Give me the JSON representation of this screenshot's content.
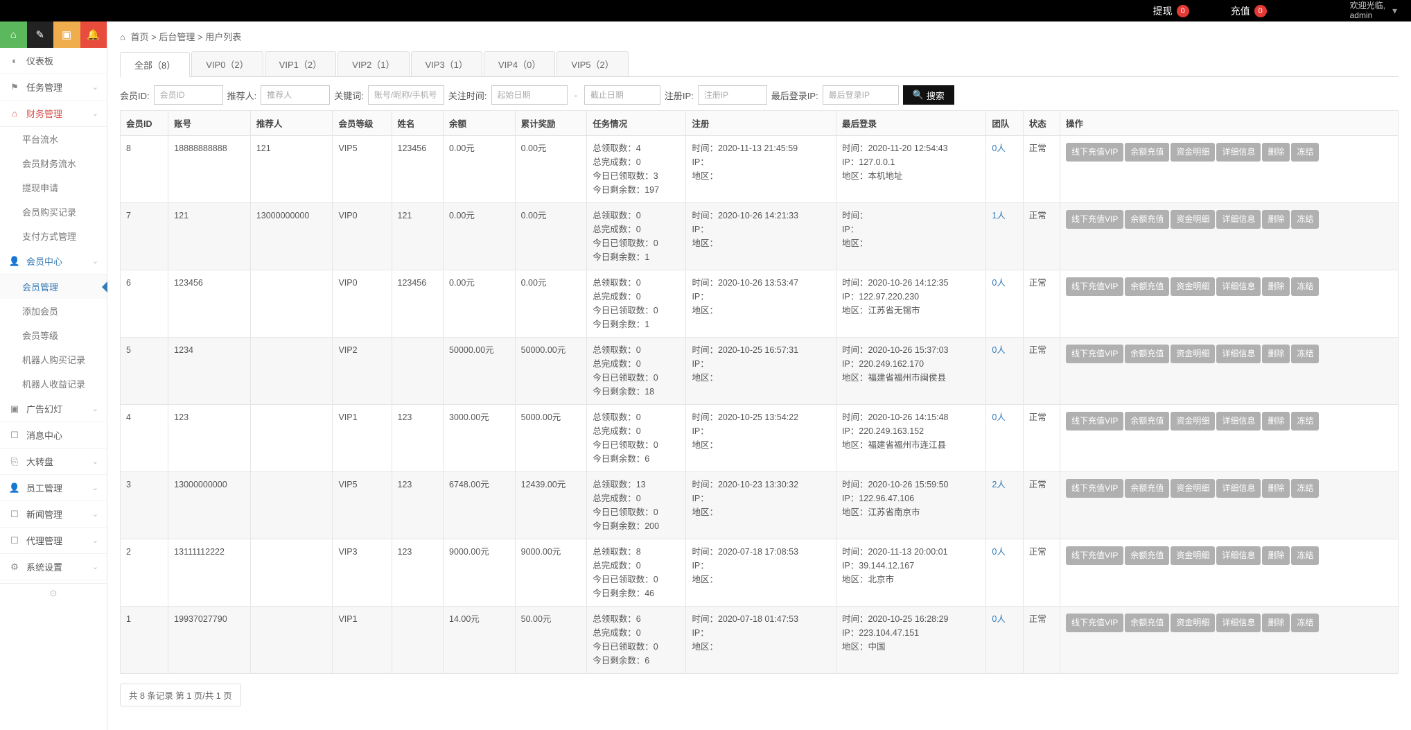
{
  "topbar": {
    "withdraw_label": "提现",
    "withdraw_count": "0",
    "recharge_label": "充值",
    "recharge_count": "0",
    "welcome": "欢迎光临,",
    "username": "admin"
  },
  "breadcrumb": {
    "home": "首页",
    "sep": ">",
    "p1": "后台管理",
    "p2": "用户列表"
  },
  "sidebar": {
    "items": [
      {
        "icon": "◐",
        "label": "仪表板",
        "nameKey": "dashboard"
      },
      {
        "icon": "⚑",
        "label": "任务管理",
        "nameKey": "tasks",
        "chev": true
      },
      {
        "icon": "⌂",
        "label": "财务管理",
        "nameKey": "finance",
        "chev": true,
        "open": true,
        "sub": [
          {
            "label": "平台流水"
          },
          {
            "label": "会员财务流水"
          },
          {
            "label": "提现申请"
          },
          {
            "label": "会员购买记录"
          },
          {
            "label": "支付方式管理"
          }
        ]
      },
      {
        "icon": "👤",
        "label": "会员中心",
        "nameKey": "member",
        "chev": true,
        "activeParent": true,
        "sub": [
          {
            "label": "会员管理",
            "active": true
          },
          {
            "label": "添加会员"
          },
          {
            "label": "会员等级"
          },
          {
            "label": "机器人购买记录"
          },
          {
            "label": "机器人收益记录"
          }
        ]
      },
      {
        "icon": "▣",
        "label": "广告幻灯",
        "nameKey": "ads",
        "chev": true
      },
      {
        "icon": "☐",
        "label": "消息中心",
        "nameKey": "messages"
      },
      {
        "icon": "⎘",
        "label": "大转盘",
        "nameKey": "wheel",
        "chev": true
      },
      {
        "icon": "👤",
        "label": "员工管理",
        "nameKey": "staff",
        "chev": true
      },
      {
        "icon": "☐",
        "label": "新闻管理",
        "nameKey": "news",
        "chev": true
      },
      {
        "icon": "☐",
        "label": "代理管理",
        "nameKey": "agent",
        "chev": true
      },
      {
        "icon": "⚙",
        "label": "系统设置",
        "nameKey": "settings",
        "chev": true
      }
    ],
    "collapse_icon": "⊙"
  },
  "tabs": [
    {
      "label": "全部（8）",
      "active": true
    },
    {
      "label": "VIP0（2）"
    },
    {
      "label": "VIP1（2）"
    },
    {
      "label": "VIP2（1）"
    },
    {
      "label": "VIP3（1）"
    },
    {
      "label": "VIP4（0）"
    },
    {
      "label": "VIP5（2）"
    }
  ],
  "filters": {
    "member_id_label": "会员ID:",
    "member_id_ph": "会员ID",
    "referrer_label": "推荐人:",
    "referrer_ph": "推荐人",
    "keyword_label": "关键词:",
    "keyword_ph": "账号/昵称/手机号",
    "close_time_label": "关注时间:",
    "start_ph": "起始日期",
    "end_ph": "截止日期",
    "reg_ip_label": "注册IP:",
    "reg_ip_ph": "注册IP",
    "last_ip_label": "最后登录IP:",
    "last_ip_ph": "最后登录IP",
    "search_label": "搜索"
  },
  "columns": [
    "会员ID",
    "账号",
    "推荐人",
    "会员等级",
    "姓名",
    "余额",
    "累计奖励",
    "任务情况",
    "注册",
    "最后登录",
    "团队",
    "状态",
    "操作"
  ],
  "task_labels": {
    "total": "总领取数：",
    "complete": "总完成数：",
    "today_claim": "今日已领取数：",
    "today_left": "今日剩余数："
  },
  "info_labels": {
    "time": "时间：",
    "ip": "IP：",
    "area": "地区："
  },
  "actions": [
    "线下充值VIP",
    "余额充值",
    "资金明细",
    "详细信息",
    "删除",
    "冻结"
  ],
  "status_normal": "正常",
  "rows": [
    {
      "id": "8",
      "acct": "18888888888",
      "ref": "121",
      "level": "VIP5",
      "name": "123456",
      "bal": "0.00元",
      "reward": "0.00元",
      "task": {
        "total": "4",
        "complete": "0",
        "today_claim": "3",
        "today_left": "197"
      },
      "reg": {
        "time": "2020-11-13 21:45:59",
        "ip": "",
        "area": ""
      },
      "last": {
        "time": "2020-11-20 12:54:43",
        "ip": "127.0.0.1",
        "area": "本机地址"
      },
      "team": "0人",
      "status": "正常"
    },
    {
      "id": "7",
      "acct": "121",
      "ref": "13000000000",
      "level": "VIP0",
      "name": "121",
      "bal": "0.00元",
      "reward": "0.00元",
      "task": {
        "total": "0",
        "complete": "0",
        "today_claim": "0",
        "today_left": "1"
      },
      "reg": {
        "time": "2020-10-26 14:21:33",
        "ip": "",
        "area": ""
      },
      "last": {
        "time": "",
        "ip": "",
        "area": ""
      },
      "team": "1人",
      "status": "正常"
    },
    {
      "id": "6",
      "acct": "123456",
      "ref": "",
      "level": "VIP0",
      "name": "123456",
      "bal": "0.00元",
      "reward": "0.00元",
      "task": {
        "total": "0",
        "complete": "0",
        "today_claim": "0",
        "today_left": "1"
      },
      "reg": {
        "time": "2020-10-26 13:53:47",
        "ip": "",
        "area": ""
      },
      "last": {
        "time": "2020-10-26 14:12:35",
        "ip": "122.97.220.230",
        "area": "江苏省无锡市"
      },
      "team": "0人",
      "status": "正常"
    },
    {
      "id": "5",
      "acct": "1234",
      "ref": "",
      "level": "VIP2",
      "name": "",
      "bal": "50000.00元",
      "reward": "50000.00元",
      "task": {
        "total": "0",
        "complete": "0",
        "today_claim": "0",
        "today_left": "18"
      },
      "reg": {
        "time": "2020-10-25 16:57:31",
        "ip": "",
        "area": ""
      },
      "last": {
        "time": "2020-10-26 15:37:03",
        "ip": "220.249.162.170",
        "area": "福建省福州市闽侯县"
      },
      "team": "0人",
      "status": "正常"
    },
    {
      "id": "4",
      "acct": "123",
      "ref": "",
      "level": "VIP1",
      "name": "123",
      "bal": "3000.00元",
      "reward": "5000.00元",
      "task": {
        "total": "0",
        "complete": "0",
        "today_claim": "0",
        "today_left": "6"
      },
      "reg": {
        "time": "2020-10-25 13:54:22",
        "ip": "",
        "area": ""
      },
      "last": {
        "time": "2020-10-26 14:15:48",
        "ip": "220.249.163.152",
        "area": "福建省福州市连江县"
      },
      "team": "0人",
      "status": "正常"
    },
    {
      "id": "3",
      "acct": "13000000000",
      "ref": "",
      "level": "VIP5",
      "name": "123",
      "bal": "6748.00元",
      "reward": "12439.00元",
      "task": {
        "total": "13",
        "complete": "0",
        "today_claim": "0",
        "today_left": "200"
      },
      "reg": {
        "time": "2020-10-23 13:30:32",
        "ip": "",
        "area": ""
      },
      "last": {
        "time": "2020-10-26 15:59:50",
        "ip": "122.96.47.106",
        "area": "江苏省南京市"
      },
      "team": "2人",
      "status": "正常"
    },
    {
      "id": "2",
      "acct": "13111112222",
      "ref": "",
      "level": "VIP3",
      "name": "123",
      "bal": "9000.00元",
      "reward": "9000.00元",
      "task": {
        "total": "8",
        "complete": "0",
        "today_claim": "0",
        "today_left": "46"
      },
      "reg": {
        "time": "2020-07-18 17:08:53",
        "ip": "",
        "area": ""
      },
      "last": {
        "time": "2020-11-13 20:00:01",
        "ip": "39.144.12.167",
        "area": "北京市"
      },
      "team": "0人",
      "status": "正常"
    },
    {
      "id": "1",
      "acct": "19937027790",
      "ref": "",
      "level": "VIP1",
      "name": "",
      "bal": "14.00元",
      "reward": "50.00元",
      "task": {
        "total": "6",
        "complete": "0",
        "today_claim": "0",
        "today_left": "6"
      },
      "reg": {
        "time": "2020-07-18 01:47:53",
        "ip": "",
        "area": ""
      },
      "last": {
        "time": "2020-10-25 16:28:29",
        "ip": "223.104.47.151",
        "area": "中国"
      },
      "team": "0人",
      "status": "正常"
    }
  ],
  "pager_text": "共 8 条记录 第 1 页/共 1 页"
}
